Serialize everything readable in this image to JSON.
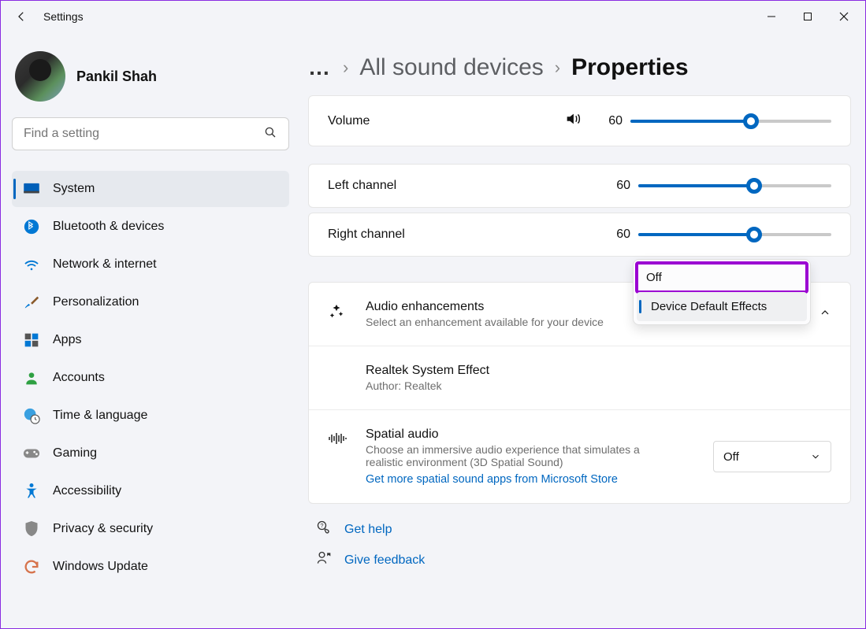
{
  "window": {
    "title": "Settings"
  },
  "user": {
    "name": "Pankil Shah"
  },
  "search": {
    "placeholder": "Find a setting"
  },
  "sidebar": {
    "items": [
      {
        "label": "System",
        "active": true
      },
      {
        "label": "Bluetooth & devices"
      },
      {
        "label": "Network & internet"
      },
      {
        "label": "Personalization"
      },
      {
        "label": "Apps"
      },
      {
        "label": "Accounts"
      },
      {
        "label": "Time & language"
      },
      {
        "label": "Gaming"
      },
      {
        "label": "Accessibility"
      },
      {
        "label": "Privacy & security"
      },
      {
        "label": "Windows Update"
      }
    ]
  },
  "breadcrumb": {
    "parent": "All sound devices",
    "current": "Properties"
  },
  "sound": {
    "volume": {
      "label": "Volume",
      "value": 60
    },
    "left": {
      "label": "Left channel",
      "value": 60
    },
    "right": {
      "label": "Right channel",
      "value": 60
    }
  },
  "enhancements": {
    "title": "Audio enhancements",
    "desc": "Select an enhancement available for your device",
    "options": [
      "Off",
      "Device Default Effects"
    ],
    "selected": "Device Default Effects",
    "highlighted": "Off",
    "realtek": {
      "title": "Realtek System Effect",
      "author": "Author: Realtek"
    }
  },
  "spatial": {
    "title": "Spatial audio",
    "desc": "Choose an immersive audio experience that simulates a realistic environment (3D Spatial Sound)",
    "link": "Get more spatial sound apps from Microsoft Store",
    "value": "Off"
  },
  "footer": {
    "help": "Get help",
    "feedback": "Give feedback"
  },
  "colors": {
    "accent": "#0067c0",
    "highlight": "#9b00d2"
  }
}
